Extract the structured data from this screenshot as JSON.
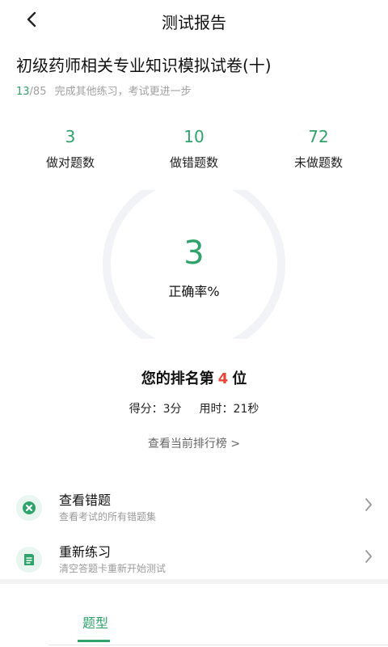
{
  "header": {
    "title": "测试报告"
  },
  "exam": {
    "title": "初级药师相关专业知识模拟试卷(十)",
    "progress_done": "13",
    "progress_total": "/85",
    "progress_hint": "完成其他练习，考试更进一步"
  },
  "stats": [
    {
      "value": "3",
      "label": "做对题数"
    },
    {
      "value": "10",
      "label": "做错题数"
    },
    {
      "value": "72",
      "label": "未做题数"
    }
  ],
  "accuracy": {
    "value": "3",
    "label": "正确率%",
    "fraction": 0.03
  },
  "rank": {
    "prefix": "您的排名第",
    "position": "4",
    "suffix": "位"
  },
  "score": {
    "score_text": "得分：3分",
    "time_text": "用时：21秒"
  },
  "leaderboard_link": "查看当前排行榜 >",
  "actions": [
    {
      "title": "查看错题",
      "subtitle": "查看考试的所有错题集",
      "icon": "close-circle-icon"
    },
    {
      "title": "重新练习",
      "subtitle": "清空答题卡重新开始测试",
      "icon": "note-icon"
    }
  ],
  "tab": {
    "label": "题型"
  },
  "colors": {
    "accent": "#2fa36b",
    "rank_highlight": "#e8443a",
    "ring_track": "#f1f3f6"
  }
}
